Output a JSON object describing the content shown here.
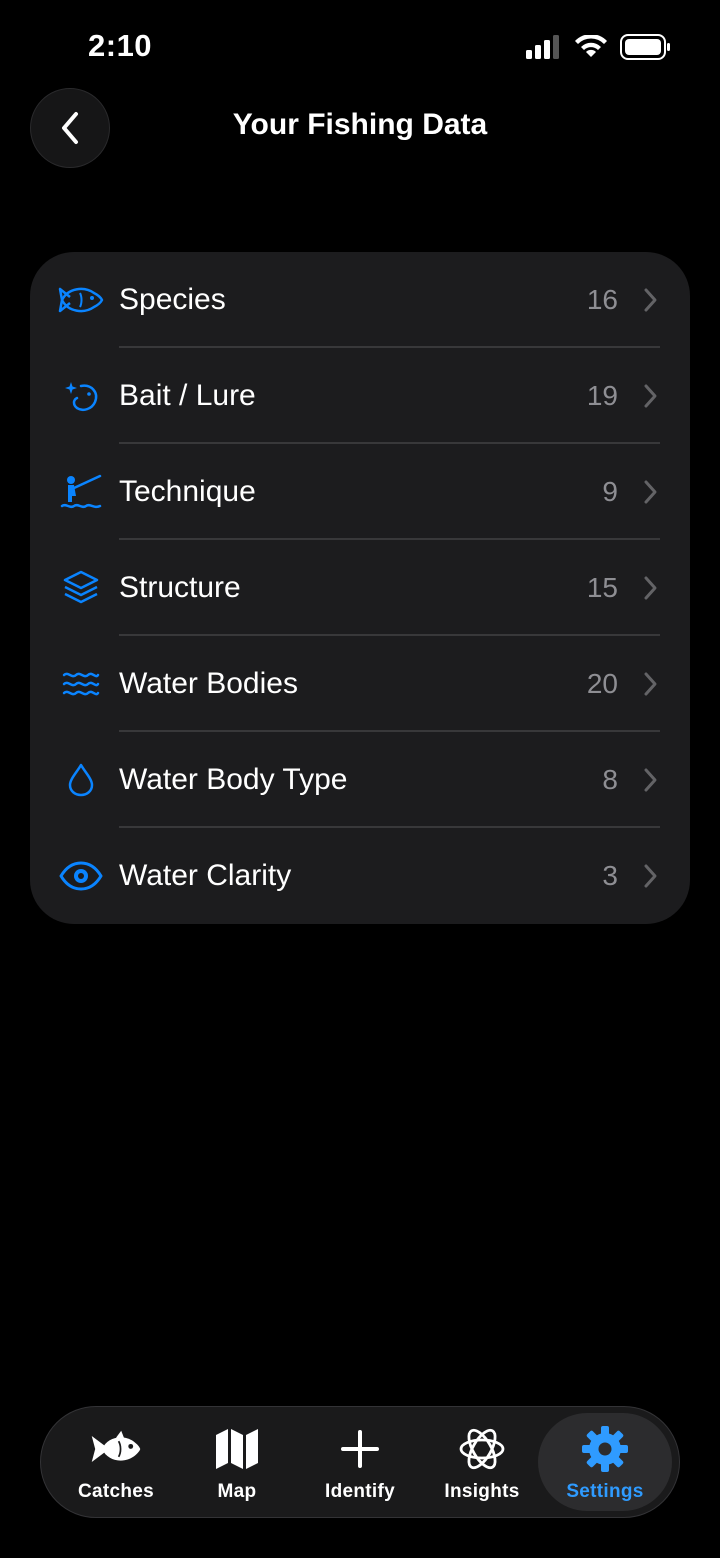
{
  "status_bar": {
    "time": "2:10"
  },
  "header": {
    "title": "Your Fishing Data",
    "back_icon": "chevron-left-icon"
  },
  "colors": {
    "accent": "#0a84ff",
    "card_bg": "#1c1c1e",
    "secondary_text": "#8e8e93",
    "active_tab_text": "#2f9bff"
  },
  "data_items": [
    {
      "label": "Species",
      "count": "16",
      "icon": "fish-icon"
    },
    {
      "label": "Bait / Lure",
      "count": "19",
      "icon": "bait-lure-icon"
    },
    {
      "label": "Technique",
      "count": "9",
      "icon": "fisherman-icon"
    },
    {
      "label": "Structure",
      "count": "15",
      "icon": "layers-icon"
    },
    {
      "label": "Water Bodies",
      "count": "20",
      "icon": "water-waves-icon"
    },
    {
      "label": "Water Body Type",
      "count": "8",
      "icon": "water-drop-icon"
    },
    {
      "label": "Water Clarity",
      "count": "3",
      "icon": "eye-icon"
    }
  ],
  "tab_bar": {
    "tabs": [
      {
        "label": "Catches",
        "icon": "fish-icon",
        "active": false
      },
      {
        "label": "Map",
        "icon": "map-icon",
        "active": false
      },
      {
        "label": "Identify",
        "icon": "plus-icon",
        "active": false
      },
      {
        "label": "Insights",
        "icon": "atom-icon",
        "active": false
      },
      {
        "label": "Settings",
        "icon": "gear-icon",
        "active": true
      }
    ]
  }
}
